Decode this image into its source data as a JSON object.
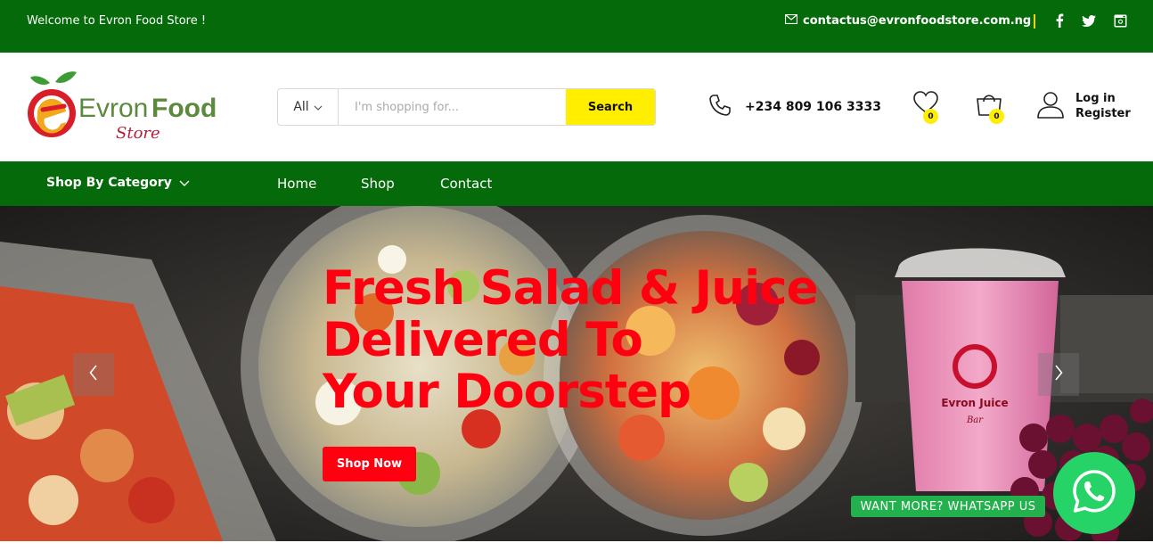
{
  "topbar": {
    "welcome": "Welcome to Evron Food Store !",
    "email": "contactus@evronfoodstore.com.ng",
    "icons": [
      "mail-icon",
      "facebook-icon",
      "twitter-icon",
      "instagram-icon"
    ]
  },
  "header": {
    "logo": {
      "word1": "Evron",
      "word2": "Food",
      "word3": "Store"
    },
    "search": {
      "category": "All",
      "placeholder": "I'm shopping for...",
      "button": "Search"
    },
    "phone": "+234 809 106 3333",
    "wishlist_count": "0",
    "cart_count": "0",
    "login": {
      "line1": "Log in",
      "line2": "Register"
    }
  },
  "nav": {
    "category_menu": "Shop By Category",
    "links": [
      "Home",
      "Shop",
      "Contact"
    ]
  },
  "hero": {
    "headline_lines": [
      "Fresh Salad & Juice",
      "Delivered To",
      "Your Doorstep"
    ],
    "cta": "Shop Now",
    "cup_brand": "Evron Juice",
    "cup_sub": "Bar"
  },
  "whatsapp": {
    "label": "WANT MORE? WHATSAPP US"
  },
  "colors": {
    "green": "#056a0a",
    "yellow": "#ffee00",
    "red": "#ff0010",
    "whatsapp": "#25d366"
  }
}
